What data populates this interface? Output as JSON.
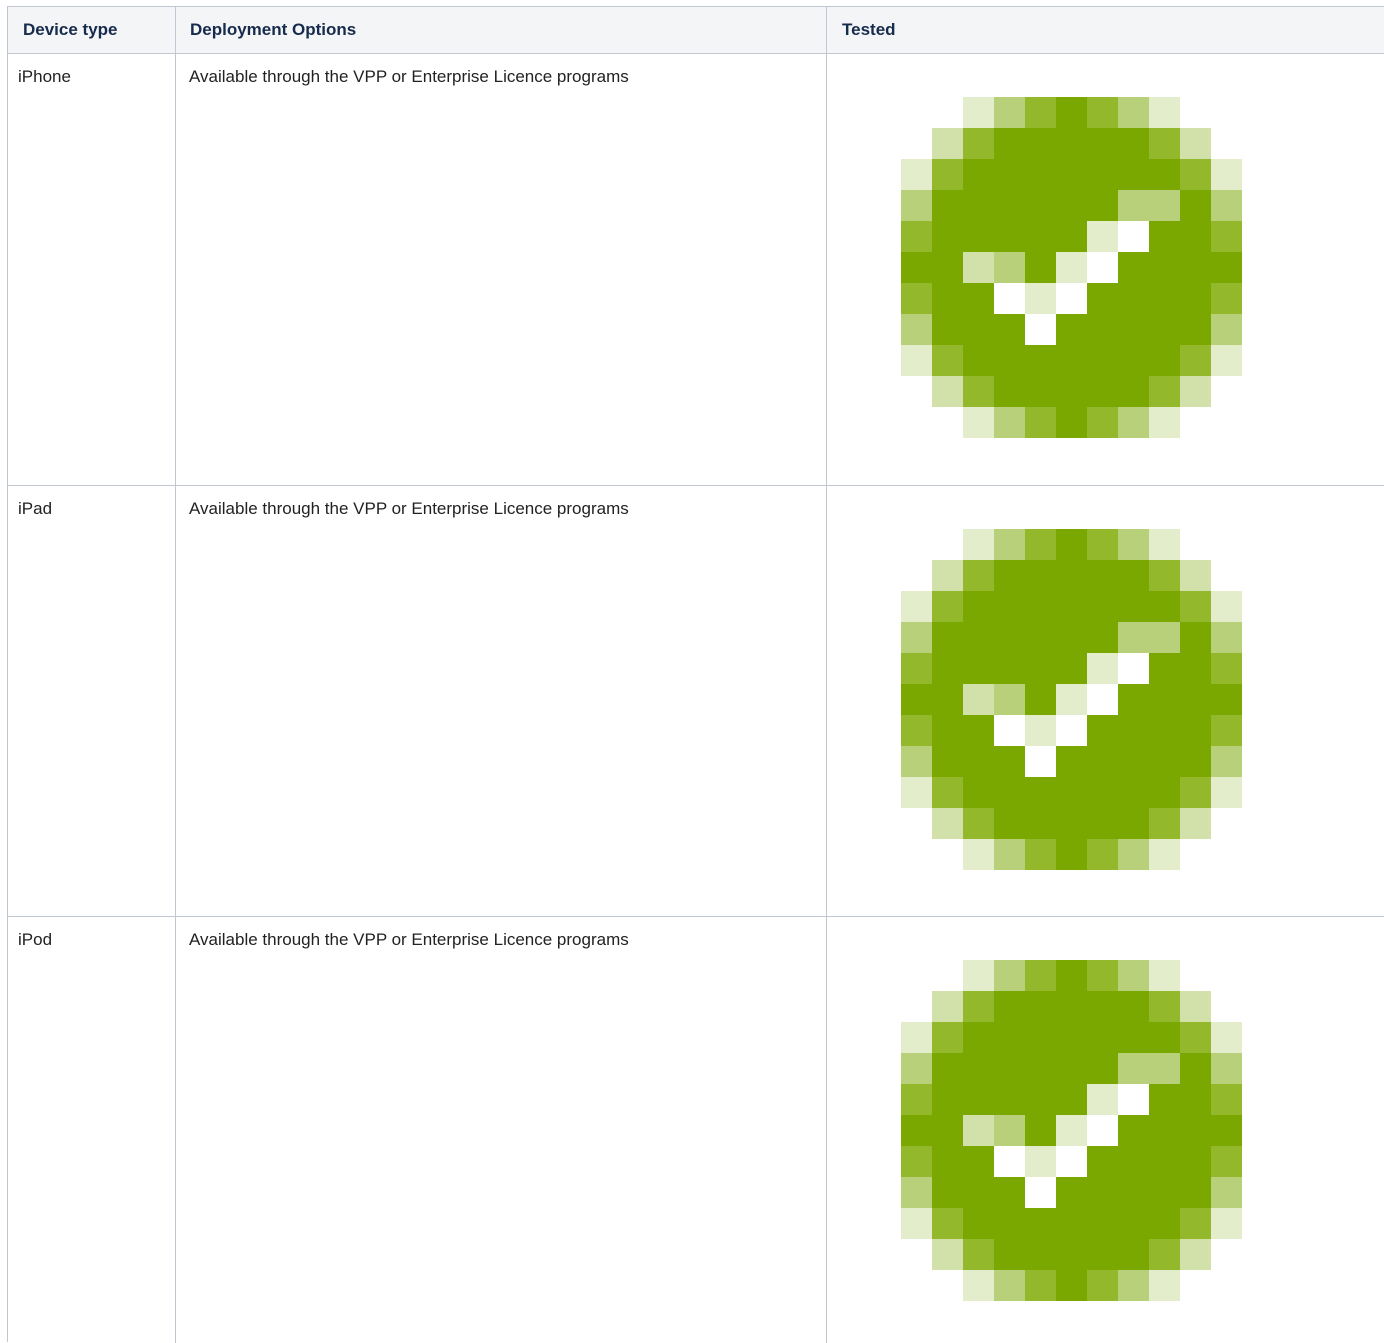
{
  "table": {
    "headers": [
      "Device type",
      "Deployment Options",
      "Tested"
    ],
    "rows": [
      {
        "device": "iPhone",
        "options": "Available through the VPP or Enterprise Licence programs",
        "tested_icon": "check-icon"
      },
      {
        "device": "iPad",
        "options": "Available through the VPP or Enterprise Licence programs",
        "tested_icon": "check-icon"
      },
      {
        "device": "iPod",
        "options": "Available through the VPP or Enterprise Licence programs",
        "tested_icon": "check-icon"
      }
    ]
  },
  "colors": {
    "green_dark": "#7aa800",
    "green_mid": "#93b82c",
    "green_light": "#b8d07a",
    "green_pale": "#d1e1a9",
    "green_faint": "#e3edcb",
    "border": "#c1c7d0",
    "header_bg": "#f4f5f7"
  }
}
